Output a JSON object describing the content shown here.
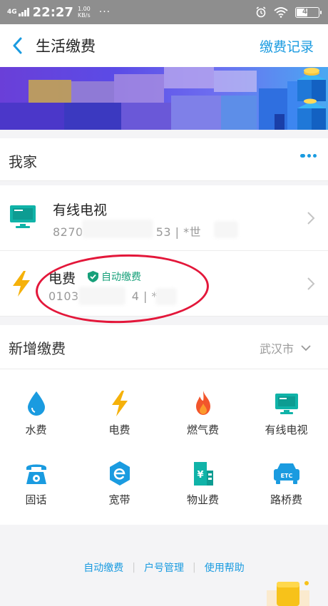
{
  "status_bar": {
    "network": "4G",
    "time": "22:27",
    "speed_value": "1.00",
    "speed_unit": "KB/s",
    "more": "···",
    "battery": "47"
  },
  "nav": {
    "title": "生活缴费",
    "right_link": "缴费记录",
    "back_icon": "chevron-left-icon"
  },
  "my_home": {
    "title": "我家",
    "bills": [
      {
        "name": "有线电视",
        "account": "8270",
        "account_tail": "53  |  *世",
        "icon": "tv-icon"
      },
      {
        "name": "电费",
        "badge": "自动缴费",
        "account": "0103",
        "account_tail": "4  |  *",
        "icon": "lightning-icon"
      }
    ]
  },
  "new_payment": {
    "title": "新增缴费",
    "city": "武汉市",
    "items": [
      {
        "label": "水费",
        "icon": "water-drop-icon"
      },
      {
        "label": "电费",
        "icon": "lightning-icon"
      },
      {
        "label": "燃气费",
        "icon": "flame-icon"
      },
      {
        "label": "有线电视",
        "icon": "tv-icon"
      },
      {
        "label": "固话",
        "icon": "telephone-icon"
      },
      {
        "label": "宽带",
        "icon": "broadband-icon"
      },
      {
        "label": "物业费",
        "icon": "building-icon"
      },
      {
        "label": "路桥费",
        "icon": "etc-car-icon"
      }
    ]
  },
  "footer": {
    "links": [
      "自动缴费",
      "户号管理",
      "使用帮助"
    ],
    "separator": "|"
  },
  "colors": {
    "accent": "#1a9be0",
    "tv": "#10b3a8",
    "lightning": "#f5b10a",
    "flame": "#f2552c",
    "auto_badge": "#17a07a",
    "highlight": "#e3173a"
  }
}
